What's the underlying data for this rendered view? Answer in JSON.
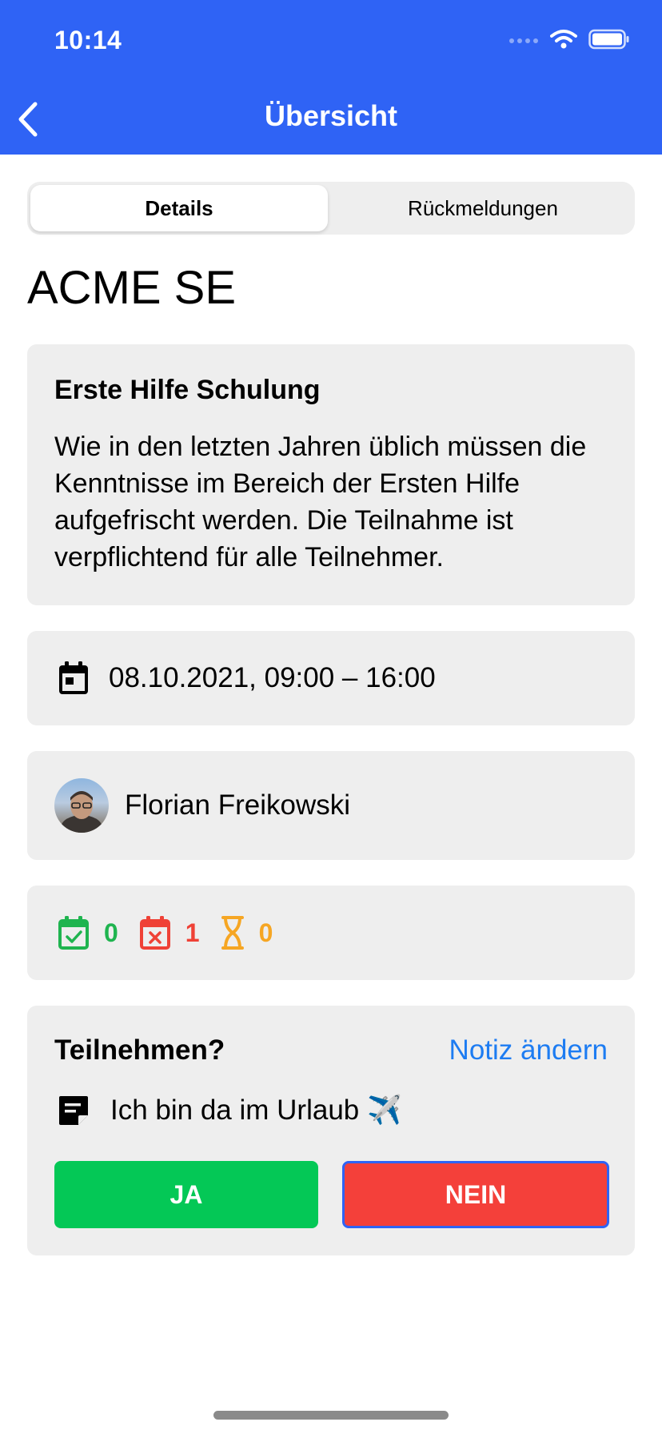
{
  "status_bar": {
    "time": "10:14"
  },
  "nav": {
    "title": "Übersicht",
    "back_icon": "chevron-left-icon"
  },
  "tabs": [
    {
      "label": "Details",
      "selected": true
    },
    {
      "label": "Rückmeldungen",
      "selected": false
    }
  ],
  "company": "ACME SE",
  "event": {
    "title": "Erste Hilfe Schulung",
    "description": "Wie in den letzten Jahren üblich müssen die Kenntnisse im Bereich der Ersten Hilfe aufgefrischt werden. Die Teilnahme ist verpflichtend für alle Teilnehmer."
  },
  "datetime": {
    "icon": "calendar-icon",
    "text": "08.10.2021, 09:00 – 16:00"
  },
  "organizer": {
    "name": "Florian Freikowski"
  },
  "stats": {
    "accepted": {
      "icon": "calendar-check-icon",
      "count": "0",
      "color": "#1fb44f"
    },
    "declined": {
      "icon": "calendar-x-icon",
      "count": "1",
      "color": "#ef4136"
    },
    "pending": {
      "icon": "hourglass-icon",
      "count": "0",
      "color": "#f6a623"
    }
  },
  "participation": {
    "question": "Teilnehmen?",
    "edit_note": "Notiz ändern",
    "note_icon": "note-icon",
    "note": "Ich bin da im Urlaub ✈️",
    "yes_label": "JA",
    "no_label": "NEIN"
  },
  "colors": {
    "header": "#2f63f5",
    "yes": "#04c856",
    "no": "#f4403a",
    "link": "#1d7cf2"
  }
}
